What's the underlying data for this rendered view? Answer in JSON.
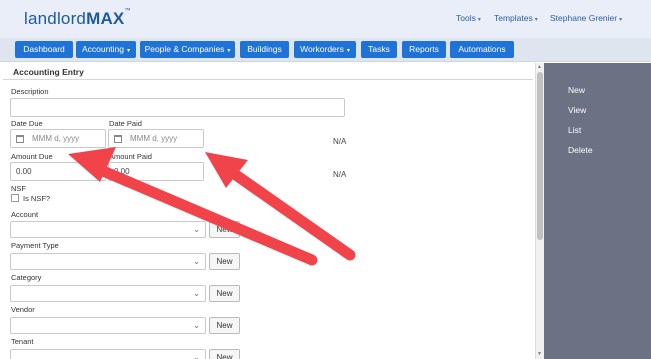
{
  "header": {
    "logo_light": "landlord",
    "logo_bold": "MAX",
    "logo_tm": "™",
    "menus": [
      "Tools",
      "Templates",
      "Stephane Grenier"
    ]
  },
  "nav": {
    "items": [
      {
        "label": "Dashboard",
        "dropdown": false
      },
      {
        "label": "Accounting",
        "dropdown": true
      },
      {
        "label": "People & Companies",
        "dropdown": true
      },
      {
        "label": "Buildings",
        "dropdown": false
      },
      {
        "label": "Workorders",
        "dropdown": true
      },
      {
        "label": "Tasks",
        "dropdown": false
      },
      {
        "label": "Reports",
        "dropdown": false
      },
      {
        "label": "Automations",
        "dropdown": false
      }
    ]
  },
  "form": {
    "section_title": "Accounting Entry",
    "description_label": "Description",
    "date_due_label": "Date Due",
    "date_paid_label": "Date Paid",
    "date_placeholder": "MMM d, yyyy",
    "amount_due_label": "Amount Due",
    "amount_paid_label": "Amount Paid",
    "amount_due_value": "0.00",
    "amount_paid_value": "0.00",
    "na_1": "N/A",
    "na_2": "N/A",
    "nsf_label": "NSF",
    "nsf_checkbox_label": "Is NSF?",
    "account_label": "Account",
    "payment_type_label": "Payment Type",
    "category_label": "Category",
    "vendor_label": "Vendor",
    "tenant_label": "Tenant",
    "new_label": "New"
  },
  "side": {
    "items": [
      "New",
      "View",
      "List",
      "Delete"
    ]
  },
  "icons": {
    "caret": "▾",
    "chevron": "⌄",
    "calendar": "calendar-icon"
  },
  "colors": {
    "nav_button": "#1f73d6",
    "side_panel": "#6c7283",
    "annotation_arrow": "#f0434a"
  }
}
